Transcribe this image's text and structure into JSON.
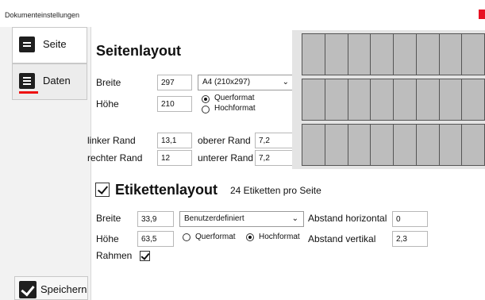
{
  "window": {
    "title": "Dokumenteinstellungen",
    "close_icon": "close-icon"
  },
  "sidebar": {
    "items": [
      {
        "label": "Seite",
        "icon": "page-icon"
      },
      {
        "label": "Daten",
        "icon": "list-icon"
      }
    ],
    "save_label": "Speichern",
    "accent": "#e11111"
  },
  "seitenlayout": {
    "title": "Seitenlayout",
    "breite_label": "Breite",
    "breite_value": "297",
    "hoehe_label": "Höhe",
    "hoehe_value": "210",
    "format_select": "A4 (210x297)",
    "orientation": {
      "quer": "Querformat",
      "hoch": "Hochformat",
      "selected": "Querformat"
    },
    "linker_rand_label": "linker Rand",
    "linker_rand_value": "13,1",
    "rechter_rand_label": "rechter Rand",
    "rechter_rand_value": "12",
    "oberer_rand_label": "oberer Rand",
    "oberer_rand_value": "7,2",
    "unterer_rand_label": "unterer Rand",
    "unterer_rand_value": "7,2"
  },
  "etikettenlayout": {
    "enabled": true,
    "title": "Etikettenlayout",
    "count_text": "24 Etiketten pro Seite",
    "breite_label": "Breite",
    "breite_value": "33,9",
    "hoehe_label": "Höhe",
    "hoehe_value": "63,5",
    "type_select": "Benutzerdefiniert",
    "orientation": {
      "quer": "Querformat",
      "hoch": "Hochformat",
      "selected": "Hochformat"
    },
    "abstand_h_label": "Abstand horizontal",
    "abstand_h_value": "0",
    "abstand_v_label": "Abstand vertikal",
    "abstand_v_value": "2,3",
    "rahmen_label": "Rahmen",
    "rahmen_checked": true
  },
  "preview": {
    "rows": 3,
    "columns": 8,
    "label_color": "#bdbdbd"
  }
}
